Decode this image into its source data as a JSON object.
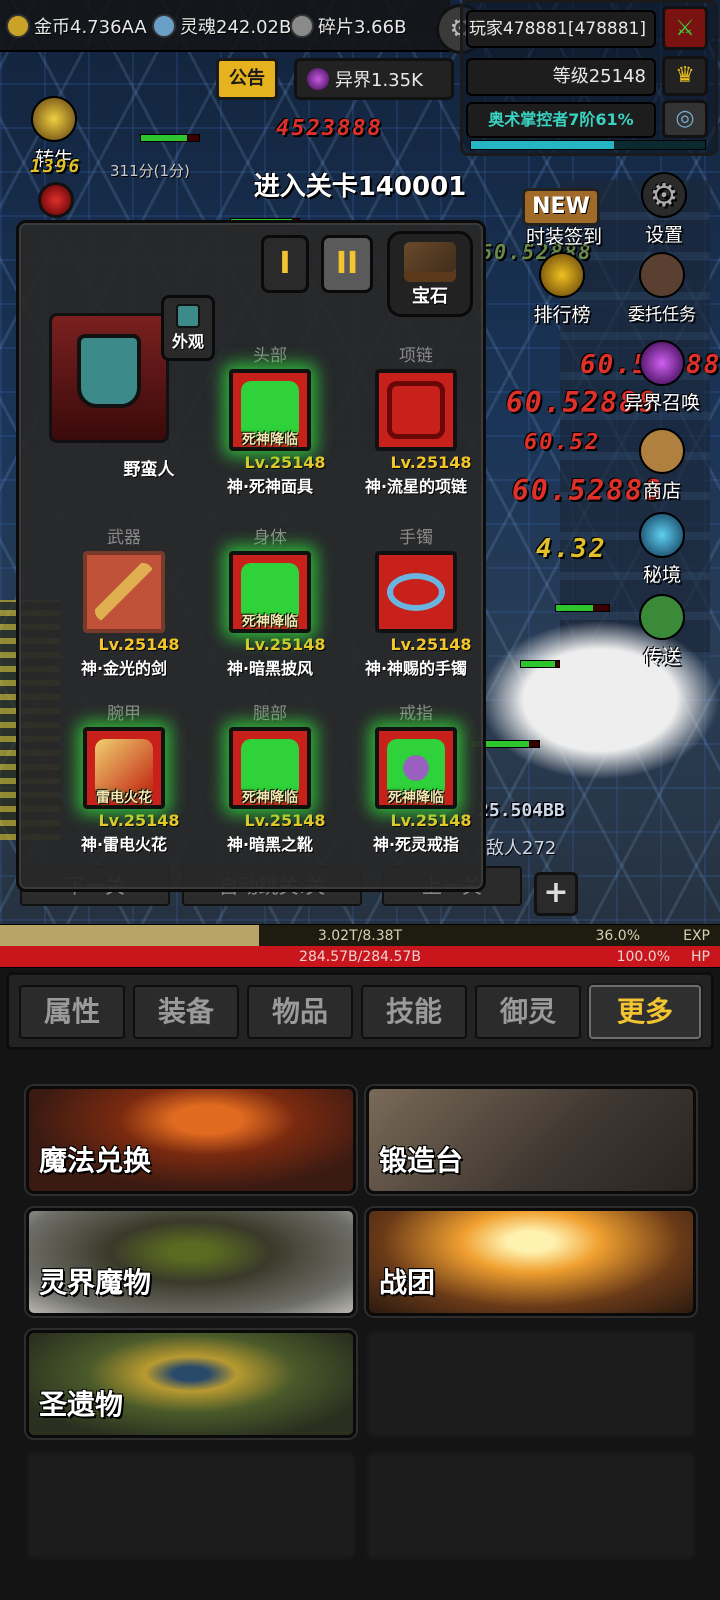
{
  "resources": {
    "gold": "金币4.736AA",
    "soul": "灵魂242.02B",
    "fragment": "碎片3.66B"
  },
  "player": {
    "name": "玩家478881[478881]",
    "level": "等级25148",
    "title": "奥术掌控者7阶61%",
    "title_progress": 0.61
  },
  "buttons": {
    "announcement": "公告",
    "otherworld": "异界1.35K",
    "rebirth": "转生",
    "rebirth_level": "1396",
    "timer": "311分(1分)"
  },
  "stage_title": "进入关卡140001",
  "side_menu": {
    "new_badge": "NEW",
    "outfit_signin": "时装签到",
    "settings": "设置",
    "ranking": "排行榜",
    "commission": "委托任务",
    "summon": "异界召唤",
    "shop": "商店",
    "secret": "秘境",
    "teleport": "传送"
  },
  "damage_numbers": [
    "60.52888",
    "60.52888",
    "60.52",
    "60.52888",
    "4.32",
    "25.504BB",
    "60.52888",
    "4523888"
  ],
  "enemy_count": "敌人272",
  "equipment": {
    "tier_buttons": [
      "I",
      "II"
    ],
    "gems_label": "宝石",
    "appearance_label": "外观",
    "hero_name": "野蛮人",
    "slots": [
      {
        "category": "头部",
        "tag": "死神降临",
        "level": "Lv.25148",
        "name": "神·死神面具",
        "color": "#2fd23a"
      },
      {
        "category": "项链",
        "tag": "",
        "level": "Lv.25148",
        "name": "神·流星的项链",
        "color": "#b01616"
      },
      {
        "category": "武器",
        "tag": "",
        "level": "Lv.25148",
        "name": "神·金光的剑",
        "color": "#d8a84a"
      },
      {
        "category": "身体",
        "tag": "死神降临",
        "level": "Lv.25148",
        "name": "神·暗黑披风",
        "color": "#2fd23a"
      },
      {
        "category": "手镯",
        "tag": "",
        "level": "Lv.25148",
        "name": "神·神赐的手镯",
        "color": "#6ab4e0"
      },
      {
        "category": "腕甲",
        "tag": "雷电火花",
        "level": "Lv.25148",
        "name": "神·雷电火花",
        "color": "#e0a020"
      },
      {
        "category": "腿部",
        "tag": "死神降临",
        "level": "Lv.25148",
        "name": "神·暗黑之靴",
        "color": "#2fd23a"
      },
      {
        "category": "戒指",
        "tag": "死神降临",
        "level": "Lv.25148",
        "name": "神·死灵戒指",
        "color": "#2fd23a"
      }
    ]
  },
  "stage_buttons": {
    "next": "下一关",
    "auto": "自动跳关:关",
    "prev": "上一关",
    "plus": "+"
  },
  "exp": {
    "value": "3.02T/8.38T",
    "percent": "36.0%",
    "label": "EXP",
    "progress": 0.36
  },
  "hp": {
    "value": "284.57B/284.57B",
    "percent": "100.0%",
    "label": "HP",
    "progress": 1.0
  },
  "tabs": [
    {
      "label": "属性"
    },
    {
      "label": "装备"
    },
    {
      "label": "物品"
    },
    {
      "label": "技能"
    },
    {
      "label": "御灵"
    },
    {
      "label": "更多"
    }
  ],
  "active_tab": 5,
  "cards": [
    {
      "label": "魔法兑换"
    },
    {
      "label": "锻造台"
    },
    {
      "label": "灵界魔物"
    },
    {
      "label": "战团"
    },
    {
      "label": "圣遗物"
    }
  ]
}
